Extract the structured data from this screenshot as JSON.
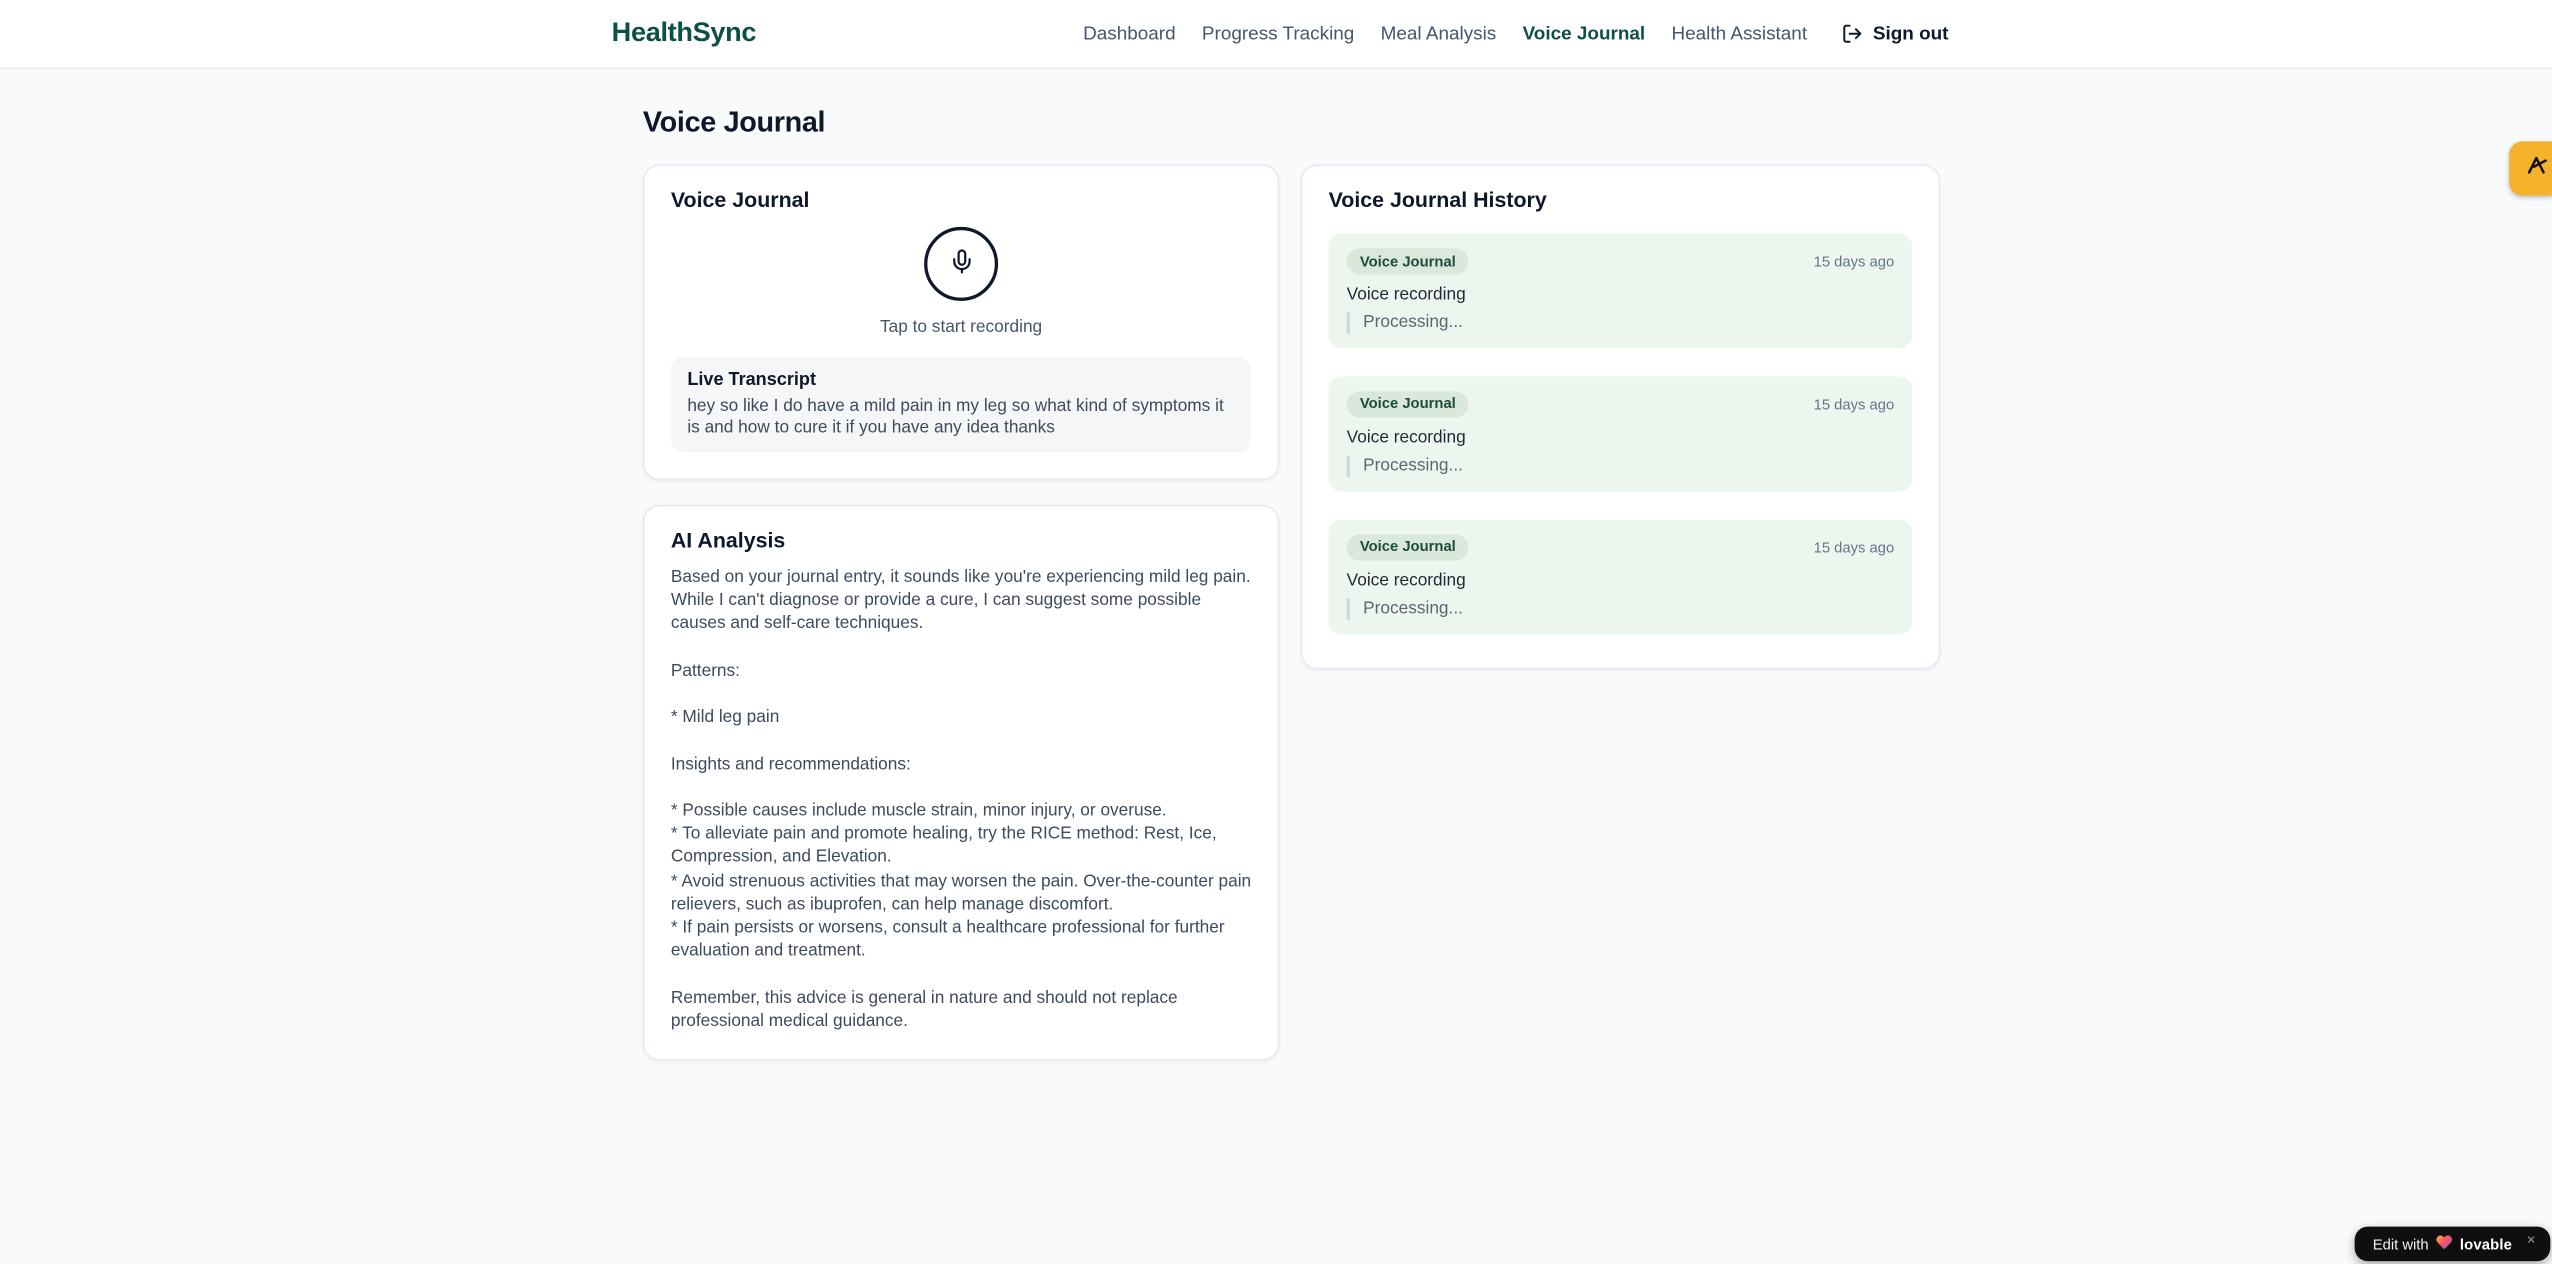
{
  "brand": {
    "name": "HealthSync"
  },
  "nav": {
    "items": [
      {
        "label": "Dashboard",
        "active": false
      },
      {
        "label": "Progress Tracking",
        "active": false
      },
      {
        "label": "Meal Analysis",
        "active": false
      },
      {
        "label": "Voice Journal",
        "active": true
      },
      {
        "label": "Health Assistant",
        "active": false
      }
    ],
    "sign_out_label": "Sign out"
  },
  "page": {
    "title": "Voice Journal"
  },
  "recorder": {
    "title": "Voice Journal",
    "tap_hint": "Tap to start recording",
    "transcript_title": "Live Transcript",
    "transcript_text": "hey so like I do have a mild pain in my leg so what kind of symptoms it is and how to cure it if you have any idea thanks"
  },
  "analysis": {
    "title": "AI Analysis",
    "body": "Based on your journal entry, it sounds like you're experiencing mild leg pain. While I can't diagnose or provide a cure, I can suggest some possible causes and self-care techniques.\n\nPatterns:\n\n* Mild leg pain\n\nInsights and recommendations:\n\n* Possible causes include muscle strain, minor injury, or overuse.\n* To alleviate pain and promote healing, try the RICE method: Rest, Ice, Compression, and Elevation.\n* Avoid strenuous activities that may worsen the pain. Over-the-counter pain relievers, such as ibuprofen, can help manage discomfort.\n* If pain persists or worsens, consult a healthcare professional for further evaluation and treatment.\n\nRemember, this advice is general in nature and should not replace professional medical guidance."
  },
  "history": {
    "title": "Voice Journal History",
    "entries": [
      {
        "badge": "Voice Journal",
        "time": "15 days ago",
        "title": "Voice recording",
        "status": "Processing..."
      },
      {
        "badge": "Voice Journal",
        "time": "15 days ago",
        "title": "Voice recording",
        "status": "Processing..."
      },
      {
        "badge": "Voice Journal",
        "time": "15 days ago",
        "title": "Voice recording",
        "status": "Processing..."
      }
    ]
  },
  "floating": {
    "lovable_prefix": "Edit with",
    "lovable_brand": "lovable",
    "lovable_close": "×"
  },
  "colors": {
    "accent_green": "#0b5045",
    "history_entry_bg": "#edf6ee",
    "badge_bg": "#d9e8da",
    "assistant_badge_amber": "#f6b22b",
    "lovable_bg": "#0f0f10"
  }
}
